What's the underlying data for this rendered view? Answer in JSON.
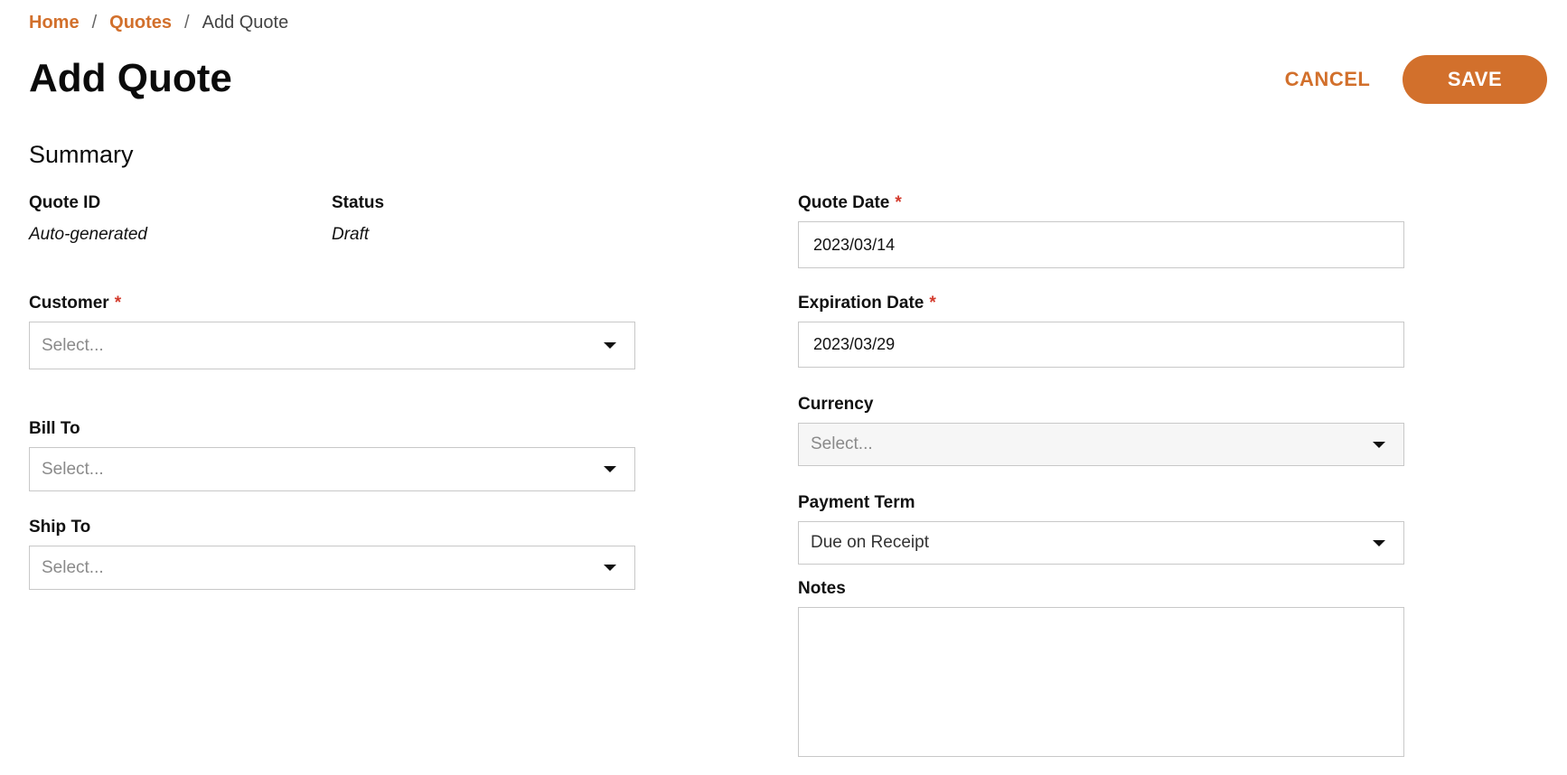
{
  "breadcrumb": {
    "home": "Home",
    "separator": "/",
    "quotes": "Quotes",
    "current": "Add Quote"
  },
  "header": {
    "title": "Add Quote",
    "cancel_label": "CANCEL",
    "save_label": "SAVE"
  },
  "summary": {
    "title": "Summary",
    "quote_id": {
      "label": "Quote ID",
      "value": "Auto-generated"
    },
    "status": {
      "label": "Status",
      "value": "Draft"
    },
    "customer": {
      "label": "Customer",
      "required_mark": "*",
      "placeholder": "Select..."
    },
    "bill_to": {
      "label": "Bill To",
      "placeholder": "Select..."
    },
    "ship_to": {
      "label": "Ship To",
      "placeholder": "Select..."
    },
    "quote_date": {
      "label": "Quote Date",
      "required_mark": "*",
      "value": "2023/03/14"
    },
    "expiration_date": {
      "label": "Expiration Date",
      "required_mark": "*",
      "value": "2023/03/29"
    },
    "currency": {
      "label": "Currency",
      "placeholder": "Select..."
    },
    "payment_term": {
      "label": "Payment Term",
      "value": "Due on Receipt"
    },
    "notes": {
      "label": "Notes",
      "value": ""
    }
  },
  "colors": {
    "accent": "#d2702c",
    "required": "#d33a2c"
  }
}
